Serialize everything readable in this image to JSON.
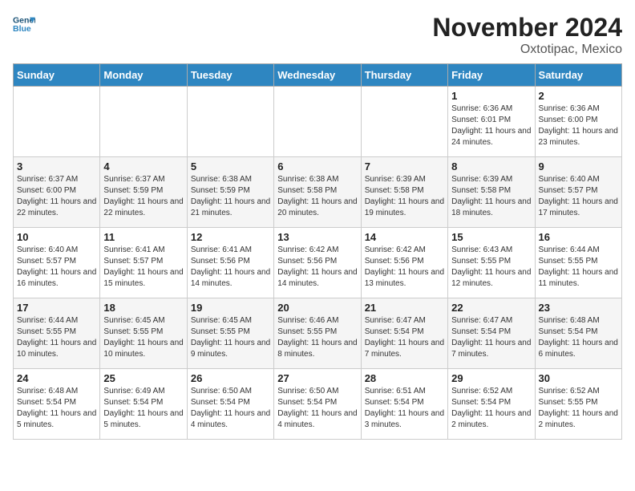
{
  "header": {
    "logo_line1": "General",
    "logo_line2": "Blue",
    "month": "November 2024",
    "location": "Oxtotipac, Mexico"
  },
  "days_of_week": [
    "Sunday",
    "Monday",
    "Tuesday",
    "Wednesday",
    "Thursday",
    "Friday",
    "Saturday"
  ],
  "weeks": [
    [
      {
        "day": "",
        "info": ""
      },
      {
        "day": "",
        "info": ""
      },
      {
        "day": "",
        "info": ""
      },
      {
        "day": "",
        "info": ""
      },
      {
        "day": "",
        "info": ""
      },
      {
        "day": "1",
        "info": "Sunrise: 6:36 AM\nSunset: 6:01 PM\nDaylight: 11 hours and 24 minutes."
      },
      {
        "day": "2",
        "info": "Sunrise: 6:36 AM\nSunset: 6:00 PM\nDaylight: 11 hours and 23 minutes."
      }
    ],
    [
      {
        "day": "3",
        "info": "Sunrise: 6:37 AM\nSunset: 6:00 PM\nDaylight: 11 hours and 22 minutes."
      },
      {
        "day": "4",
        "info": "Sunrise: 6:37 AM\nSunset: 5:59 PM\nDaylight: 11 hours and 22 minutes."
      },
      {
        "day": "5",
        "info": "Sunrise: 6:38 AM\nSunset: 5:59 PM\nDaylight: 11 hours and 21 minutes."
      },
      {
        "day": "6",
        "info": "Sunrise: 6:38 AM\nSunset: 5:58 PM\nDaylight: 11 hours and 20 minutes."
      },
      {
        "day": "7",
        "info": "Sunrise: 6:39 AM\nSunset: 5:58 PM\nDaylight: 11 hours and 19 minutes."
      },
      {
        "day": "8",
        "info": "Sunrise: 6:39 AM\nSunset: 5:58 PM\nDaylight: 11 hours and 18 minutes."
      },
      {
        "day": "9",
        "info": "Sunrise: 6:40 AM\nSunset: 5:57 PM\nDaylight: 11 hours and 17 minutes."
      }
    ],
    [
      {
        "day": "10",
        "info": "Sunrise: 6:40 AM\nSunset: 5:57 PM\nDaylight: 11 hours and 16 minutes."
      },
      {
        "day": "11",
        "info": "Sunrise: 6:41 AM\nSunset: 5:57 PM\nDaylight: 11 hours and 15 minutes."
      },
      {
        "day": "12",
        "info": "Sunrise: 6:41 AM\nSunset: 5:56 PM\nDaylight: 11 hours and 14 minutes."
      },
      {
        "day": "13",
        "info": "Sunrise: 6:42 AM\nSunset: 5:56 PM\nDaylight: 11 hours and 14 minutes."
      },
      {
        "day": "14",
        "info": "Sunrise: 6:42 AM\nSunset: 5:56 PM\nDaylight: 11 hours and 13 minutes."
      },
      {
        "day": "15",
        "info": "Sunrise: 6:43 AM\nSunset: 5:55 PM\nDaylight: 11 hours and 12 minutes."
      },
      {
        "day": "16",
        "info": "Sunrise: 6:44 AM\nSunset: 5:55 PM\nDaylight: 11 hours and 11 minutes."
      }
    ],
    [
      {
        "day": "17",
        "info": "Sunrise: 6:44 AM\nSunset: 5:55 PM\nDaylight: 11 hours and 10 minutes."
      },
      {
        "day": "18",
        "info": "Sunrise: 6:45 AM\nSunset: 5:55 PM\nDaylight: 11 hours and 10 minutes."
      },
      {
        "day": "19",
        "info": "Sunrise: 6:45 AM\nSunset: 5:55 PM\nDaylight: 11 hours and 9 minutes."
      },
      {
        "day": "20",
        "info": "Sunrise: 6:46 AM\nSunset: 5:55 PM\nDaylight: 11 hours and 8 minutes."
      },
      {
        "day": "21",
        "info": "Sunrise: 6:47 AM\nSunset: 5:54 PM\nDaylight: 11 hours and 7 minutes."
      },
      {
        "day": "22",
        "info": "Sunrise: 6:47 AM\nSunset: 5:54 PM\nDaylight: 11 hours and 7 minutes."
      },
      {
        "day": "23",
        "info": "Sunrise: 6:48 AM\nSunset: 5:54 PM\nDaylight: 11 hours and 6 minutes."
      }
    ],
    [
      {
        "day": "24",
        "info": "Sunrise: 6:48 AM\nSunset: 5:54 PM\nDaylight: 11 hours and 5 minutes."
      },
      {
        "day": "25",
        "info": "Sunrise: 6:49 AM\nSunset: 5:54 PM\nDaylight: 11 hours and 5 minutes."
      },
      {
        "day": "26",
        "info": "Sunrise: 6:50 AM\nSunset: 5:54 PM\nDaylight: 11 hours and 4 minutes."
      },
      {
        "day": "27",
        "info": "Sunrise: 6:50 AM\nSunset: 5:54 PM\nDaylight: 11 hours and 4 minutes."
      },
      {
        "day": "28",
        "info": "Sunrise: 6:51 AM\nSunset: 5:54 PM\nDaylight: 11 hours and 3 minutes."
      },
      {
        "day": "29",
        "info": "Sunrise: 6:52 AM\nSunset: 5:54 PM\nDaylight: 11 hours and 2 minutes."
      },
      {
        "day": "30",
        "info": "Sunrise: 6:52 AM\nSunset: 5:55 PM\nDaylight: 11 hours and 2 minutes."
      }
    ]
  ]
}
